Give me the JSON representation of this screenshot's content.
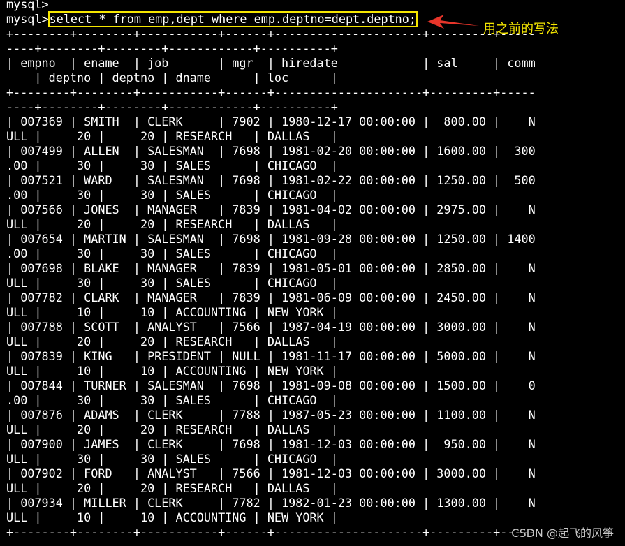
{
  "terminal": {
    "prompt": "mysql>",
    "command": "select * from emp,dept where emp.deptno=dept.deptno;",
    "pre_lines": [
      "mysql>"
    ],
    "lines": [
      "+--------+--------+-----------+------+---------------------+---------+-----",
      "----+--------+--------+------------+----------+",
      "| empno  | ename  | job       | mgr  | hiredate            | sal     | comm",
      "    | deptno | deptno | dname      | loc      |",
      "+--------+--------+-----------+------+---------------------+---------+-----",
      "----+--------+--------+------------+----------+",
      "| 007369 | SMITH  | CLERK     | 7902 | 1980-12-17 00:00:00 |  800.00 |    N",
      "ULL |     20 |     20 | RESEARCH   | DALLAS   |",
      "| 007499 | ALLEN  | SALESMAN  | 7698 | 1981-02-20 00:00:00 | 1600.00 |  300",
      ".00 |     30 |     30 | SALES      | CHICAGO  |",
      "| 007521 | WARD   | SALESMAN  | 7698 | 1981-02-22 00:00:00 | 1250.00 |  500",
      ".00 |     30 |     30 | SALES      | CHICAGO  |",
      "| 007566 | JONES  | MANAGER   | 7839 | 1981-04-02 00:00:00 | 2975.00 |    N",
      "ULL |     20 |     20 | RESEARCH   | DALLAS   |",
      "| 007654 | MARTIN | SALESMAN  | 7698 | 1981-09-28 00:00:00 | 1250.00 | 1400",
      ".00 |     30 |     30 | SALES      | CHICAGO  |",
      "| 007698 | BLAKE  | MANAGER   | 7839 | 1981-05-01 00:00:00 | 2850.00 |    N",
      "ULL |     30 |     30 | SALES      | CHICAGO  |",
      "| 007782 | CLARK  | MANAGER   | 7839 | 1981-06-09 00:00:00 | 2450.00 |    N",
      "ULL |     10 |     10 | ACCOUNTING | NEW YORK |",
      "| 007788 | SCOTT  | ANALYST   | 7566 | 1987-04-19 00:00:00 | 3000.00 |    N",
      "ULL |     20 |     20 | RESEARCH   | DALLAS   |",
      "| 007839 | KING   | PRESIDENT | NULL | 1981-11-17 00:00:00 | 5000.00 |    N",
      "ULL |     10 |     10 | ACCOUNTING | NEW YORK |",
      "| 007844 | TURNER | SALESMAN  | 7698 | 1981-09-08 00:00:00 | 1500.00 |    0",
      ".00 |     30 |     30 | SALES      | CHICAGO  |",
      "| 007876 | ADAMS  | CLERK     | 7788 | 1987-05-23 00:00:00 | 1100.00 |    N",
      "ULL |     20 |     20 | RESEARCH   | DALLAS   |",
      "| 007900 | JAMES  | CLERK     | 7698 | 1981-12-03 00:00:00 |  950.00 |    N",
      "ULL |     30 |     30 | SALES      | CHICAGO  |",
      "| 007902 | FORD   | ANALYST   | 7566 | 1981-12-03 00:00:00 | 3000.00 |    N",
      "ULL |     20 |     20 | RESEARCH   | DALLAS   |",
      "| 007934 | MILLER | CLERK     | 7782 | 1982-01-23 00:00:00 | 1300.00 |    N",
      "ULL |     10 |     10 | ACCOUNTING | NEW YORK |",
      "+--------+--------+-----------+------+---------------------+---------+-----"
    ]
  },
  "annotation": {
    "text": "用之前的写法",
    "color": "#f5e600",
    "arrow_color": "#e8352a"
  },
  "watermark": "CSDN @起飞的风筝",
  "colors": {
    "background": "#000000",
    "text": "#ffffff",
    "highlight": "#f5e600"
  }
}
